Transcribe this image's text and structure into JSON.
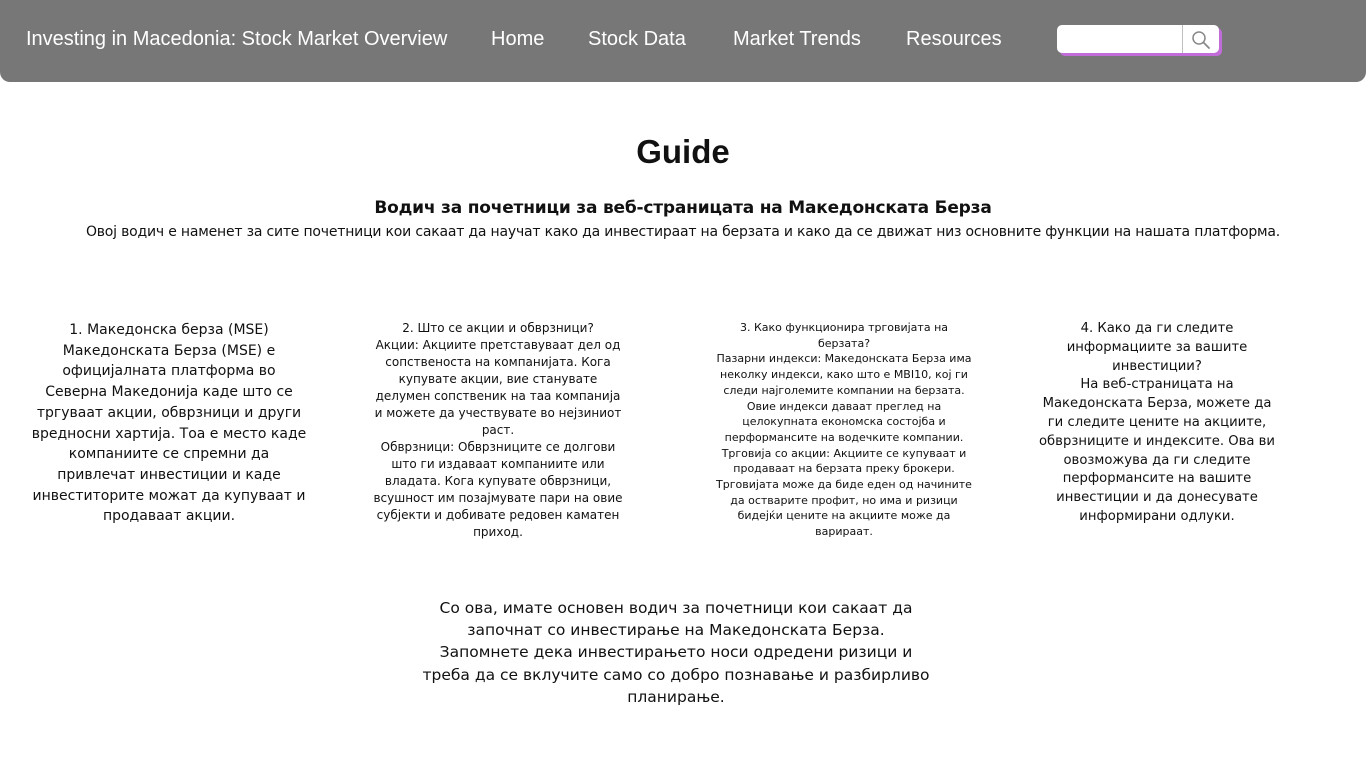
{
  "navbar": {
    "brand": "Investing in Macedonia: Stock Market Overview",
    "links": [
      "Home",
      "Stock Data",
      "Market Trends",
      "Resources"
    ],
    "search": {
      "placeholder": "",
      "value": "",
      "button_icon": "search-icon"
    },
    "colors": {
      "background": "#777777",
      "text": "#ffffff",
      "search_shadow": "#c26cd9"
    }
  },
  "main": {
    "title": "Guide",
    "subtitle": "Водич за почетници за веб-страницата на Македонската Берза",
    "intro": "Овој водич е наменет за сите почетници кои сакаат да научат како да инвестираат на берзата и како да се движат низ основните функции на нашата платформа.",
    "sections": [
      {
        "heading": "1. Македонска берза (MSE)",
        "paragraphs": [
          "Македонската Берза (MSE) е официјалната платформа во Северна Македонија каде што се тргуваат акции, обврзници и други вредносни хартија. Тоа е место каде компаниите се спремни да привлечат инвестиции и каде инвеститорите можат да купуваат и продаваат акции."
        ]
      },
      {
        "heading": "2. Што се акции и обврзници?",
        "paragraphs": [
          "Акции: Акциите претставуваат дел од сопственоста на компанијата. Кога купувате акции, вие станувате делумен сопственик на таа компанија и можете да учествувате во нејзиниот раст.",
          "Обврзници: Обврзниците се долгови што ги издаваат компаниите или владата. Кога купувате обврзници, всушност им позајмувате пари на овие субјекти и добивате редовен каматен приход."
        ]
      },
      {
        "heading": "3. Како функционира трговијата на берзата?",
        "paragraphs": [
          "Пазарни индекси: Македонската Берза има неколку индекси, како што е MBI10, кој ги следи најголемите компании на берзата. Овие индекси даваат преглед на целокупната економска состојба и перформансите на водечките компании.",
          "Трговија со акции: Акциите се купуваат и продаваат на берзата преку брокери. Трговијата може да биде еден од начините да остварите профит, но има и ризици бидејќи цените на акциите може да варираат."
        ]
      },
      {
        "heading": "4. Како да ги следите информациите за вашите инвестиции?",
        "paragraphs": [
          "На веб-страницата на Македонската Берза, можете да ги следите цените на акциите, обврзниците и индексите. Ова ви овозможува да ги следите перформансите на вашите инвестиции и да донесувате информирани одлуки."
        ]
      }
    ],
    "outro": "Со ова, имате основен водич за почетници кои сакаат да започнат со инвестирање на Македонската Берза. Запомнете дека инвестирањето носи одредени ризици и треба да се вклучите само со добро познавање и разбирливо планирање."
  }
}
